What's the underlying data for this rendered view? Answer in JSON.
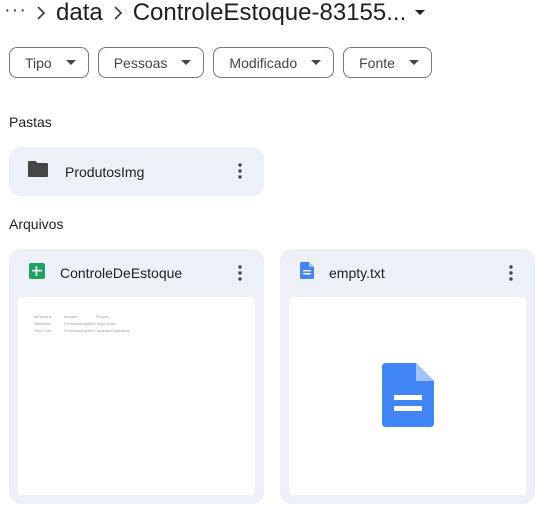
{
  "breadcrumb": {
    "more": "···",
    "items": [
      "data"
    ],
    "current": "ControleEstoque-83155..."
  },
  "filters": [
    {
      "label": "Tipo"
    },
    {
      "label": "Pessoas"
    },
    {
      "label": "Modificado"
    },
    {
      "label": "Fonte"
    }
  ],
  "sections": {
    "folders_title": "Pastas",
    "files_title": "Arquivos"
  },
  "folders": [
    {
      "name": "ProdutosImg",
      "icon": "folder-icon"
    }
  ],
  "files": [
    {
      "name": "ControleDeEstoque",
      "icon": "google-sheets-icon",
      "preview": {
        "rows": [
          [
            "idEstoque",
            "imagem",
            "Preços"
          ],
          [
            "f4a65dda",
            "ProdutosImg/f843 Imgs Kuas",
            ""
          ],
          [
            "93cc734b",
            "ProdutosImg/9cc Canetas/Cadeados",
            ""
          ]
        ]
      }
    },
    {
      "name": "empty.txt",
      "icon": "google-docs-icon"
    }
  ],
  "colors": {
    "card_bg": "#edf0f6",
    "sheets_green": "#1ea362",
    "docs_blue": "#4285f4",
    "folder_gray": "#444746"
  }
}
